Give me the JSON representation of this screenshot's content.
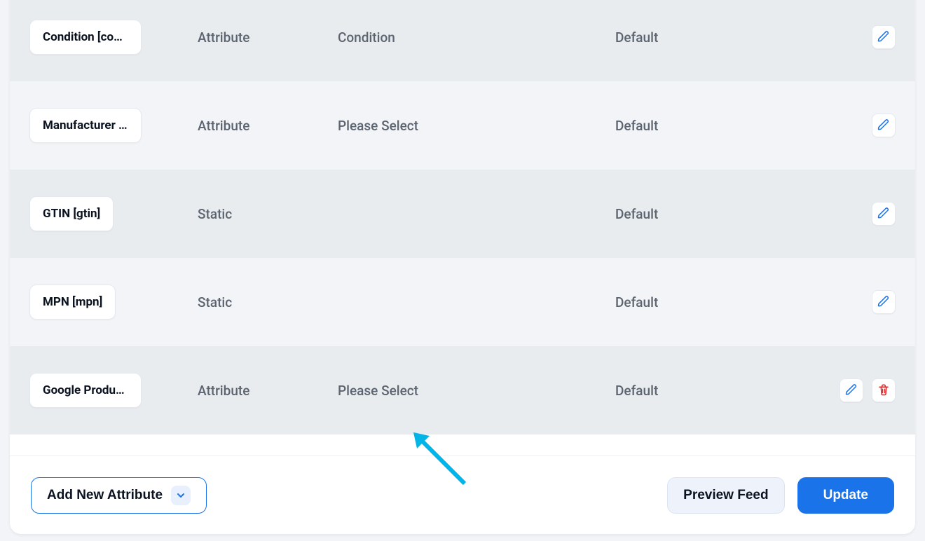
{
  "rows": [
    {
      "label": "Condition [condition]",
      "type": "Attribute",
      "value": "Condition",
      "output": "Default",
      "deletable": false
    },
    {
      "label": "Manufacturer [brand]",
      "type": "Attribute",
      "value": "Please Select",
      "output": "Default",
      "deletable": false
    },
    {
      "label": "GTIN [gtin]",
      "type": "Static",
      "value": "",
      "output": "Default",
      "deletable": false
    },
    {
      "label": "MPN [mpn]",
      "type": "Static",
      "value": "",
      "output": "Default",
      "deletable": false
    },
    {
      "label": "Google Product Category",
      "type": "Attribute",
      "value": "Please Select",
      "output": "Default",
      "deletable": true
    }
  ],
  "footer": {
    "add_label": "Add New Attribute",
    "preview_label": "Preview Feed",
    "update_label": "Update"
  },
  "icons": {
    "pencil": "pencil-icon",
    "trash": "trash-icon",
    "chevron_down": "chevron-down-icon"
  }
}
